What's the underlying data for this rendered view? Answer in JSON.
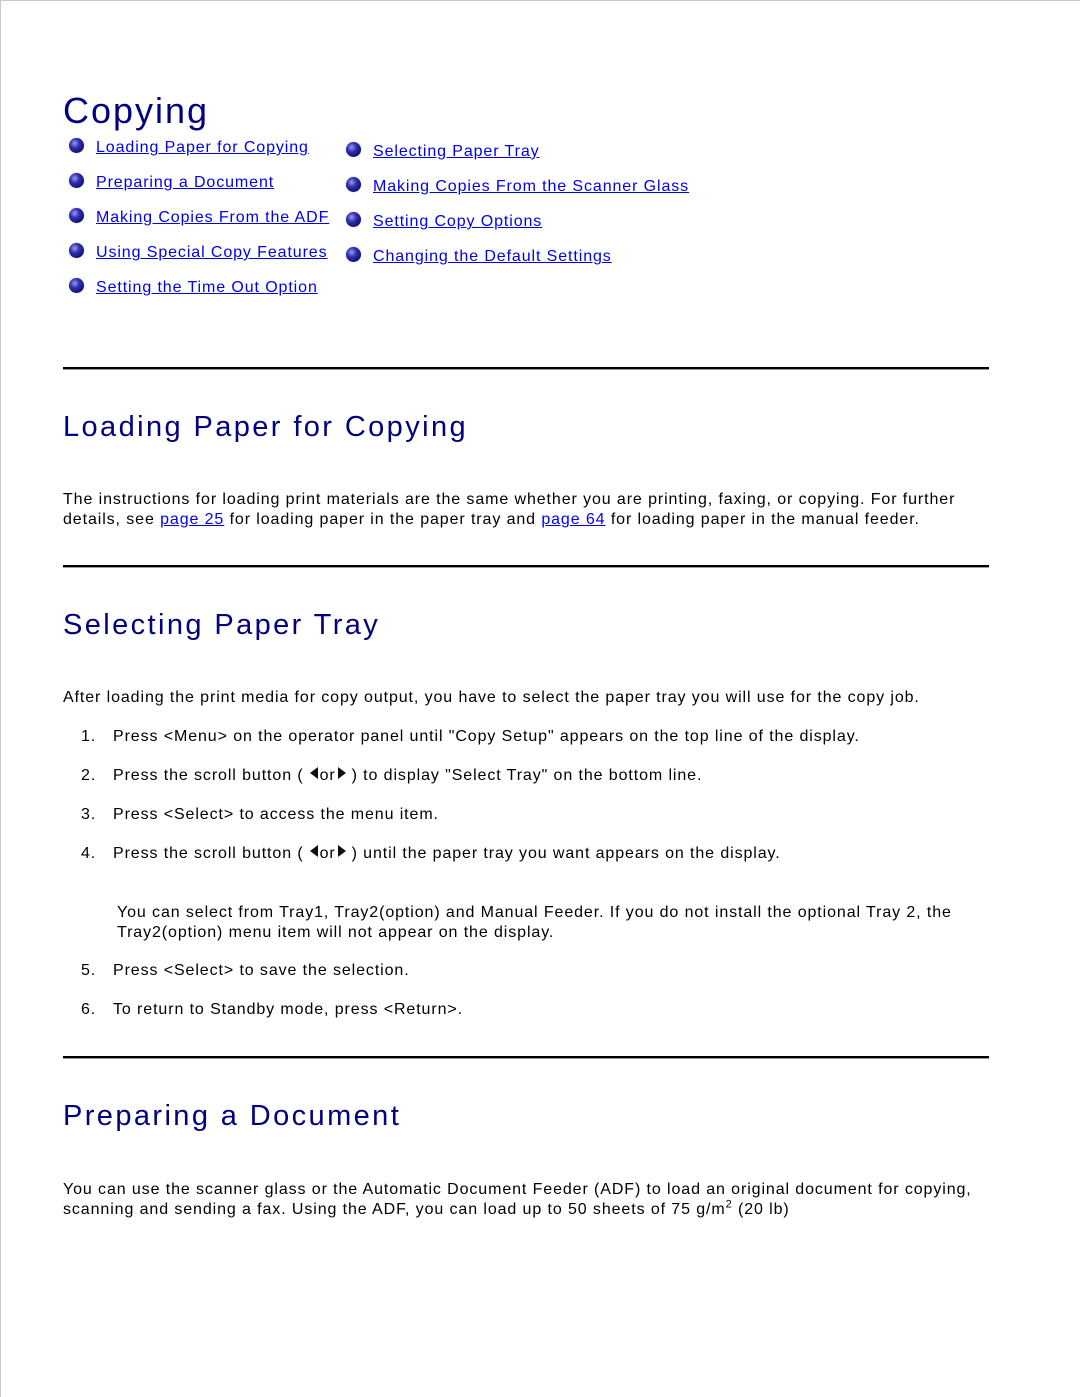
{
  "page_title": "Copying",
  "toc": {
    "left": [
      {
        "label": "Loading Paper for Copying",
        "icon": "bullet-sphere-icon"
      },
      {
        "label": "Preparing a Document",
        "icon": "bullet-sphere-icon"
      },
      {
        "label": "Making Copies From the ADF",
        "icon": "bullet-sphere-icon"
      },
      {
        "label": "Using Special Copy Features",
        "icon": "bullet-sphere-icon"
      },
      {
        "label": "Setting the Time Out Option",
        "icon": "bullet-sphere-icon"
      }
    ],
    "right": [
      {
        "label": "Selecting Paper Tray",
        "icon": "bullet-sphere-icon"
      },
      {
        "label": "Making Copies From the Scanner Glass",
        "icon": "bullet-sphere-icon"
      },
      {
        "label": "Setting Copy Options",
        "icon": "bullet-sphere-icon"
      },
      {
        "label": "Changing the Default Settings",
        "icon": "bullet-sphere-icon"
      }
    ]
  },
  "section_loading": {
    "heading": "Loading Paper for Copying",
    "text_1": "The instructions for loading print materials are the same whether you are printing, faxing, or copying. For further details, see ",
    "link_1": "page 25",
    "text_2": " for loading paper in the paper tray and ",
    "link_2": "page 64",
    "text_3": " for loading paper in the manual feeder."
  },
  "section_tray": {
    "heading": "Selecting Paper Tray",
    "intro": "After loading the print media for copy output, you have to select the paper tray you will use for the copy job.",
    "steps": [
      {
        "num": "1.",
        "text": "Press <Menu> on the operator panel until \"Copy Setup\" appears on the top line of the display."
      },
      {
        "num": "2.",
        "pre": "Press the scroll button (",
        "mid": " or ",
        "post": " ) to display \"Select Tray\" on the bottom line."
      },
      {
        "num": "3.",
        "text": "Press <Select> to access the menu item."
      },
      {
        "num": "4.",
        "pre": "Press the scroll button (",
        "mid": " or ",
        "post": " ) until the paper tray you want appears on the display."
      },
      {
        "num": "5.",
        "text": "Press <Select> to save the selection."
      },
      {
        "num": "6.",
        "text": "To return to Standby mode, press <Return>."
      }
    ],
    "note": "You can select from Tray1, Tray2(option) and Manual Feeder. If you do not install the optional Tray 2, the Tray2(option) menu item will not appear on the display.",
    "icons": {
      "left": "left-arrow-icon",
      "right": "right-arrow-icon"
    }
  },
  "section_document": {
    "heading": "Preparing a Document",
    "text_1": "You can use the scanner glass or the Automatic Document Feeder (ADF) to load an original document for copying, scanning and sending a fax. Using the ADF, you can load up to 50 sheets of 75 g/m",
    "sup": "2",
    "text_2": " (20 lb)"
  }
}
